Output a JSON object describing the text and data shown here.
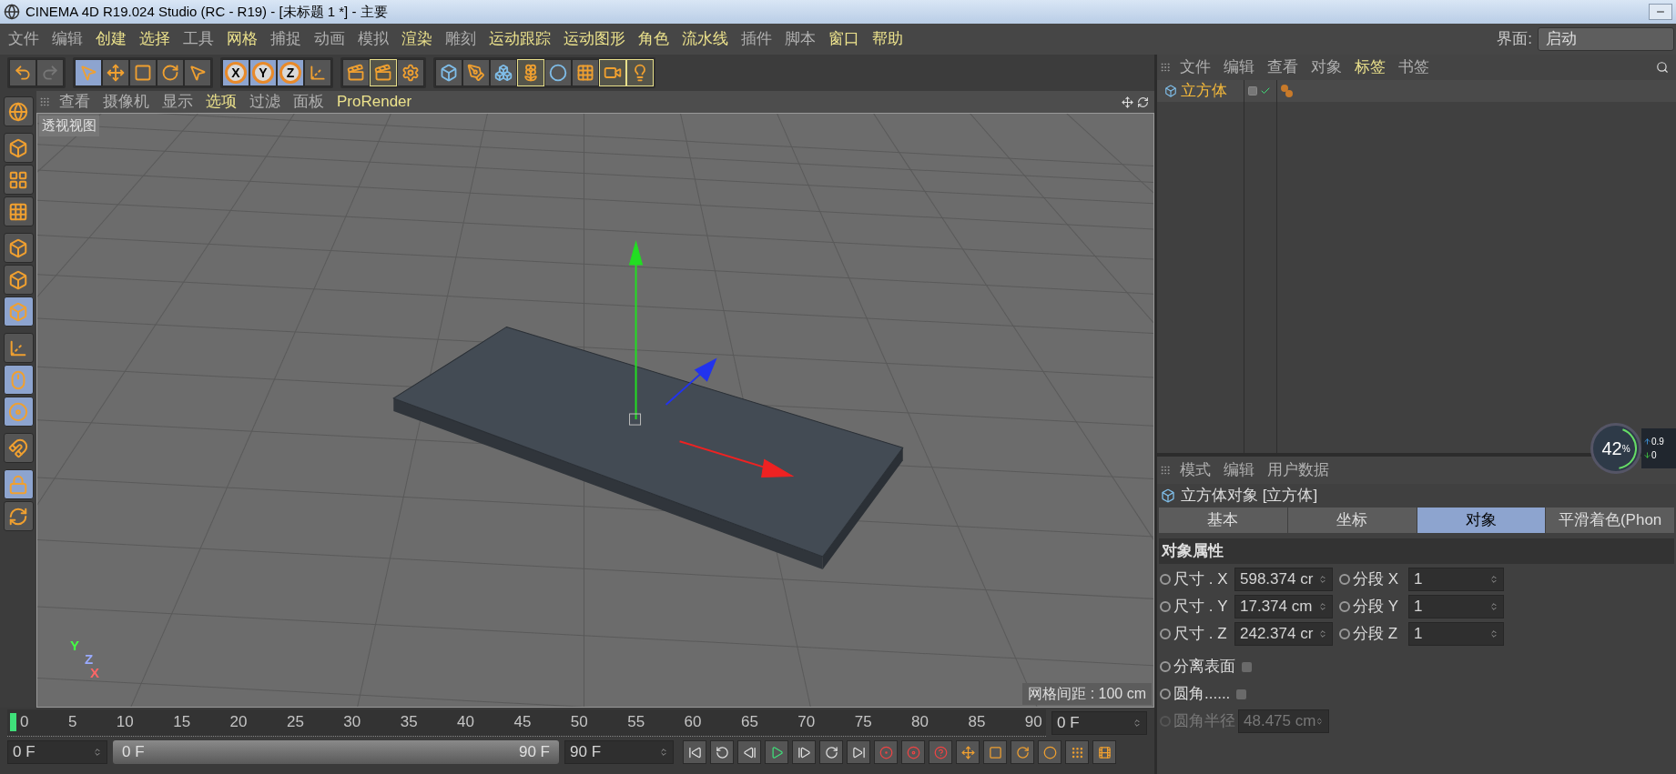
{
  "window": {
    "title": "CINEMA 4D R19.024 Studio (RC - R19) - [未标题 1 *] - 主要"
  },
  "menu_bar": {
    "items": [
      {
        "label": "文件",
        "highlighted": false
      },
      {
        "label": "编辑",
        "highlighted": false
      },
      {
        "label": "创建",
        "highlighted": true
      },
      {
        "label": "选择",
        "highlighted": true
      },
      {
        "label": "工具",
        "highlighted": false
      },
      {
        "label": "网格",
        "highlighted": true
      },
      {
        "label": "捕捉",
        "highlighted": false
      },
      {
        "label": "动画",
        "highlighted": false
      },
      {
        "label": "模拟",
        "highlighted": false
      },
      {
        "label": "渲染",
        "highlighted": true
      },
      {
        "label": "雕刻",
        "highlighted": false
      },
      {
        "label": "运动跟踪",
        "highlighted": true
      },
      {
        "label": "运动图形",
        "highlighted": true
      },
      {
        "label": "角色",
        "highlighted": true
      },
      {
        "label": "流水线",
        "highlighted": true
      },
      {
        "label": "插件",
        "highlighted": false
      },
      {
        "label": "脚本",
        "highlighted": false
      },
      {
        "label": "窗口",
        "highlighted": true
      },
      {
        "label": "帮助",
        "highlighted": true
      }
    ],
    "layout_label": "界面:",
    "layout_value": "启动"
  },
  "toolbar": {
    "groups": [
      [
        {
          "kind": "undo",
          "selected": false,
          "highlighted": false
        },
        {
          "kind": "redo",
          "selected": false,
          "highlighted": false
        }
      ],
      [
        {
          "kind": "select",
          "selected": true,
          "highlighted": false
        },
        {
          "kind": "move",
          "selected": false,
          "highlighted": false
        },
        {
          "kind": "scale",
          "selected": false,
          "highlighted": false
        },
        {
          "kind": "rotate",
          "selected": false,
          "highlighted": false
        },
        {
          "kind": "recent",
          "selected": false,
          "highlighted": false
        }
      ],
      [
        {
          "kind": "axis",
          "label": "X",
          "selected": true,
          "highlighted": false
        },
        {
          "kind": "axis",
          "label": "Y",
          "selected": true,
          "highlighted": false
        },
        {
          "kind": "axis",
          "label": "Z",
          "selected": true,
          "highlighted": false
        },
        {
          "kind": "coord",
          "selected": false,
          "highlighted": false
        }
      ],
      [
        {
          "kind": "render-view",
          "selected": false,
          "highlighted": false
        },
        {
          "kind": "render-picture",
          "selected": false,
          "highlighted": true
        },
        {
          "kind": "render-settings",
          "selected": false,
          "highlighted": false
        }
      ],
      [
        {
          "kind": "cube",
          "selected": false,
          "highlighted": false
        },
        {
          "kind": "pen",
          "selected": false,
          "highlighted": false
        },
        {
          "kind": "subdivide",
          "selected": false,
          "highlighted": false
        },
        {
          "kind": "cloner",
          "selected": false,
          "highlighted": true
        },
        {
          "kind": "deformer",
          "selected": false,
          "highlighted": false
        },
        {
          "kind": "floor",
          "selected": false,
          "highlighted": false
        },
        {
          "kind": "camera",
          "selected": false,
          "highlighted": true
        },
        {
          "kind": "light",
          "selected": false,
          "highlighted": true
        }
      ]
    ]
  },
  "left_tools": [
    {
      "kind": "view",
      "selected": false
    },
    {
      "kind": "model",
      "selected": false
    },
    {
      "kind": "texture",
      "selected": false
    },
    {
      "kind": "workplane",
      "selected": false
    },
    {
      "kind": "points",
      "selected": false
    },
    {
      "kind": "edges",
      "selected": false
    },
    {
      "kind": "polygons",
      "selected": true
    },
    {
      "kind": "axis",
      "selected": false
    },
    {
      "kind": "tweak",
      "selected": true
    },
    {
      "kind": "solo",
      "selected": true
    },
    {
      "kind": "snap",
      "selected": false
    },
    {
      "kind": "lock",
      "selected": true
    },
    {
      "kind": "sync",
      "selected": false
    }
  ],
  "viewport": {
    "menu": [
      {
        "label": "查看",
        "highlighted": false
      },
      {
        "label": "摄像机",
        "highlighted": false
      },
      {
        "label": "显示",
        "highlighted": false
      },
      {
        "label": "选项",
        "highlighted": true
      },
      {
        "label": "过滤",
        "highlighted": false
      },
      {
        "label": "面板",
        "highlighted": false
      },
      {
        "label": "ProRender",
        "highlighted": true
      }
    ],
    "label": "透视视图",
    "grid_spacing": "网格间距 : 100 cm",
    "axis_labels": [
      {
        "label": "Y",
        "color": "#44ff44"
      },
      {
        "label": "Z",
        "color": "#99aaff"
      },
      {
        "label": "X",
        "color": "#ff6666"
      }
    ]
  },
  "timeline": {
    "ticks": [
      "0",
      "5",
      "10",
      "15",
      "20",
      "25",
      "30",
      "35",
      "40",
      "45",
      "50",
      "55",
      "60",
      "65",
      "70",
      "75",
      "80",
      "85",
      "90"
    ],
    "level": 0,
    "current_frame": "0 F",
    "start": "0 F",
    "range_slider": {
      "start": "0 F",
      "end": "90 F",
      "level": 1
    },
    "end": "90 F"
  },
  "object_manager": {
    "menu": [
      {
        "label": "文件",
        "highlighted": false
      },
      {
        "label": "编辑",
        "highlighted": false
      },
      {
        "label": "查看",
        "highlighted": false
      },
      {
        "label": "对象",
        "highlighted": false
      },
      {
        "label": "标签",
        "highlighted": true
      },
      {
        "label": "书签",
        "highlighted": false
      }
    ],
    "objects": [
      {
        "name": "立方体",
        "selected": true,
        "enabled": true
      }
    ]
  },
  "attributes": {
    "menu": [
      {
        "label": "模式",
        "highlighted": false
      },
      {
        "label": "编辑",
        "highlighted": false
      },
      {
        "label": "用户数据",
        "highlighted": false
      }
    ],
    "title": "立方体对象 [立方体]",
    "tabs": [
      {
        "label": "基本",
        "selected": false
      },
      {
        "label": "坐标",
        "selected": false
      },
      {
        "label": "对象",
        "selected": true
      },
      {
        "label": "平滑着色(Phon",
        "selected": false
      }
    ],
    "section": "对象属性",
    "size_rows": [
      {
        "label": "尺寸 . X",
        "value": "598.374 cr",
        "keyframed": false,
        "segment_label": "分段 X",
        "segment_value": "1",
        "segment_keyframed": false
      },
      {
        "label": "尺寸 . Y",
        "value": "17.374 cm",
        "keyframed": false,
        "segment_label": "分段 Y",
        "segment_value": "1",
        "segment_keyframed": false
      },
      {
        "label": "尺寸 . Z",
        "value": "242.374 cr",
        "keyframed": false,
        "segment_label": "分段 Z",
        "segment_value": "1",
        "segment_keyframed": false
      }
    ],
    "options": [
      {
        "kind": "checkbox",
        "label": "分离表面",
        "checked": false,
        "disabled": false
      },
      {
        "kind": "checkbox",
        "label": "圆角......",
        "checked": false,
        "disabled": false
      },
      {
        "kind": "field",
        "label": "圆角半径",
        "value": "48.475 cm",
        "disabled": true
      }
    ]
  },
  "monitor": {
    "percent": "42",
    "unit": "%",
    "level": 0.42,
    "upload": "0.9",
    "download": "0"
  }
}
